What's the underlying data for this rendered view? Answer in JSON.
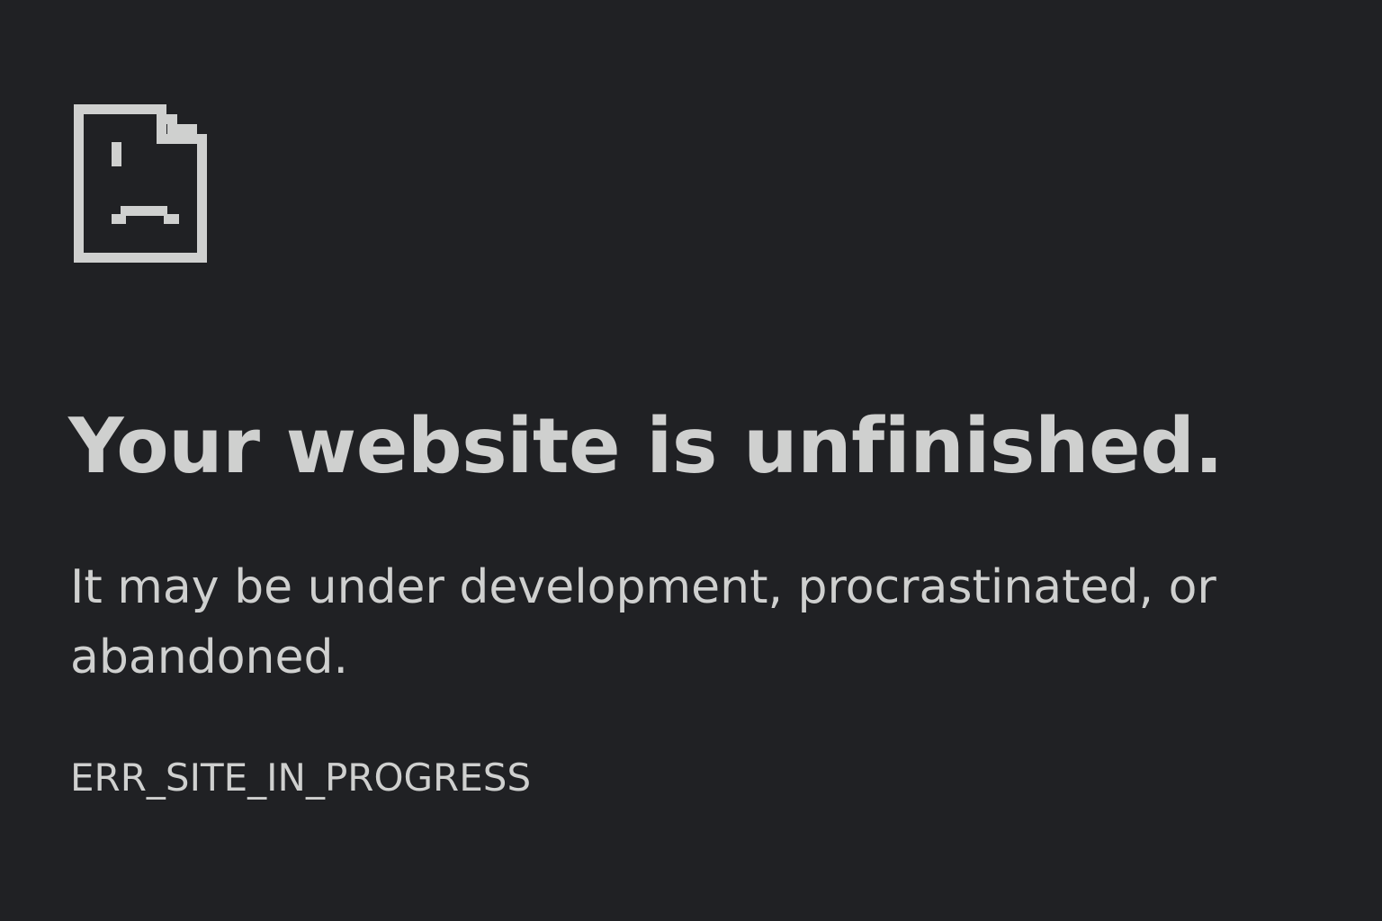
{
  "error_page": {
    "icon": "sad-document-icon",
    "icon_color": "#cfd0cf",
    "background_color": "#202124",
    "text_color": "#cfd0cf",
    "headline": "Your website is unfinished.",
    "message": "It may be under development, procrastinated, or abandoned.",
    "error_code": "ERR_SITE_IN_PROGRESS"
  }
}
